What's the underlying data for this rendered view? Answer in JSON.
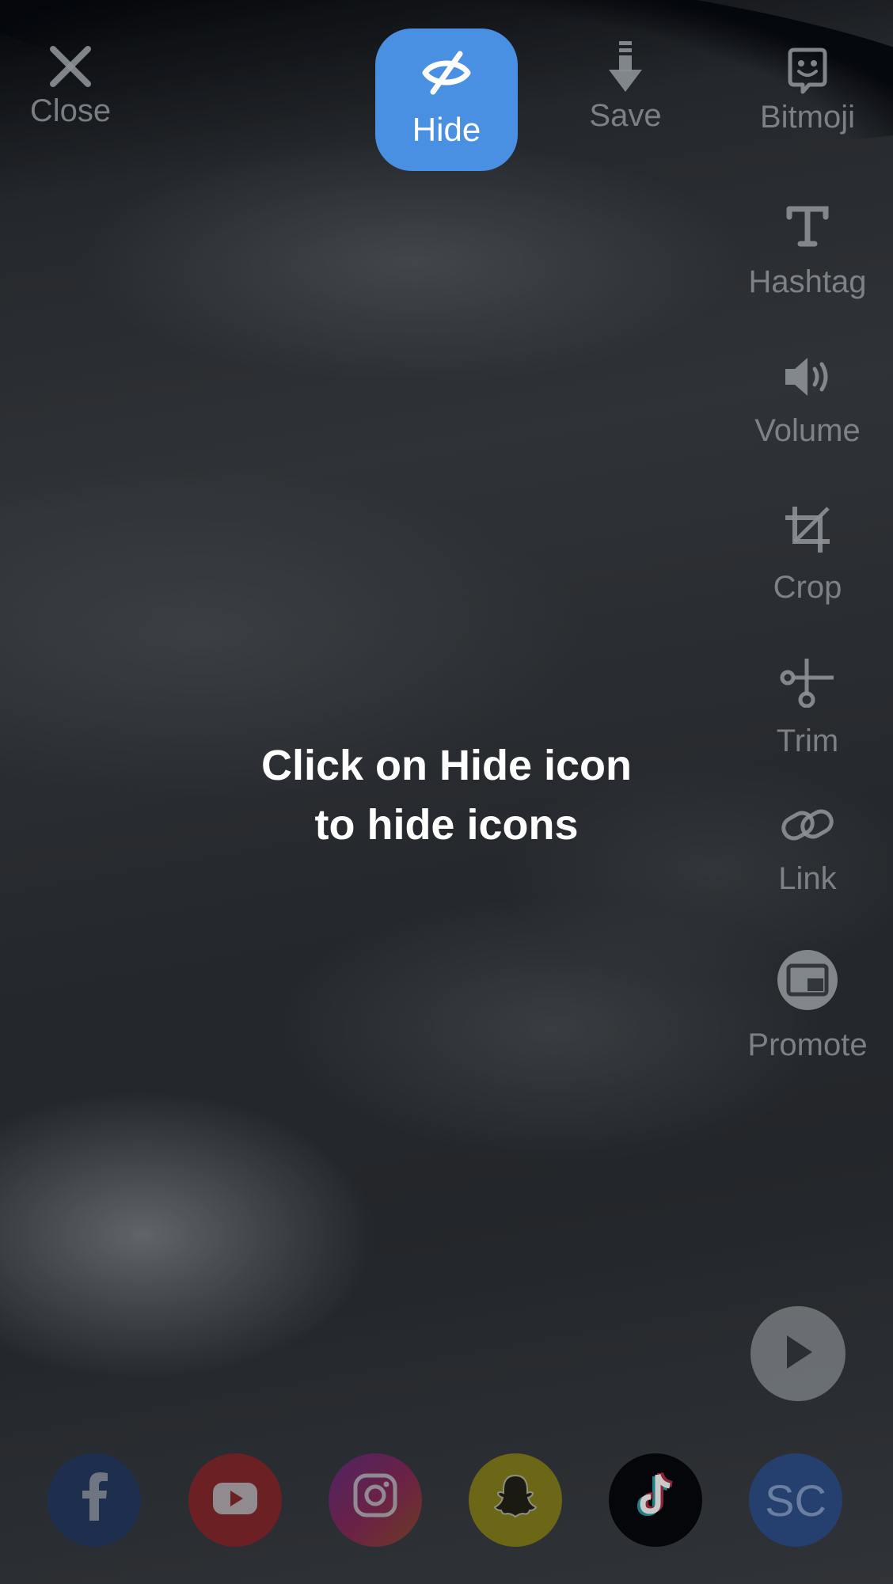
{
  "top_bar": {
    "close_label": "Close",
    "hide_label": "Hide",
    "save_label": "Save",
    "bitmoji_label": "Bitmoji"
  },
  "side_tools": [
    {
      "label": "Hashtag",
      "icon": "text-t-icon"
    },
    {
      "label": "Volume",
      "icon": "speaker-icon"
    },
    {
      "label": "Crop",
      "icon": "crop-icon"
    },
    {
      "label": "Trim",
      "icon": "trim-icon"
    },
    {
      "label": "Link",
      "icon": "link-icon"
    },
    {
      "label": "Promote",
      "icon": "promote-icon"
    }
  ],
  "hint": {
    "line1": "Click on Hide icon",
    "line2": "to hide icons"
  },
  "share": {
    "sc_label": "SC"
  },
  "colors": {
    "hide_accent": "#4a90e2"
  }
}
